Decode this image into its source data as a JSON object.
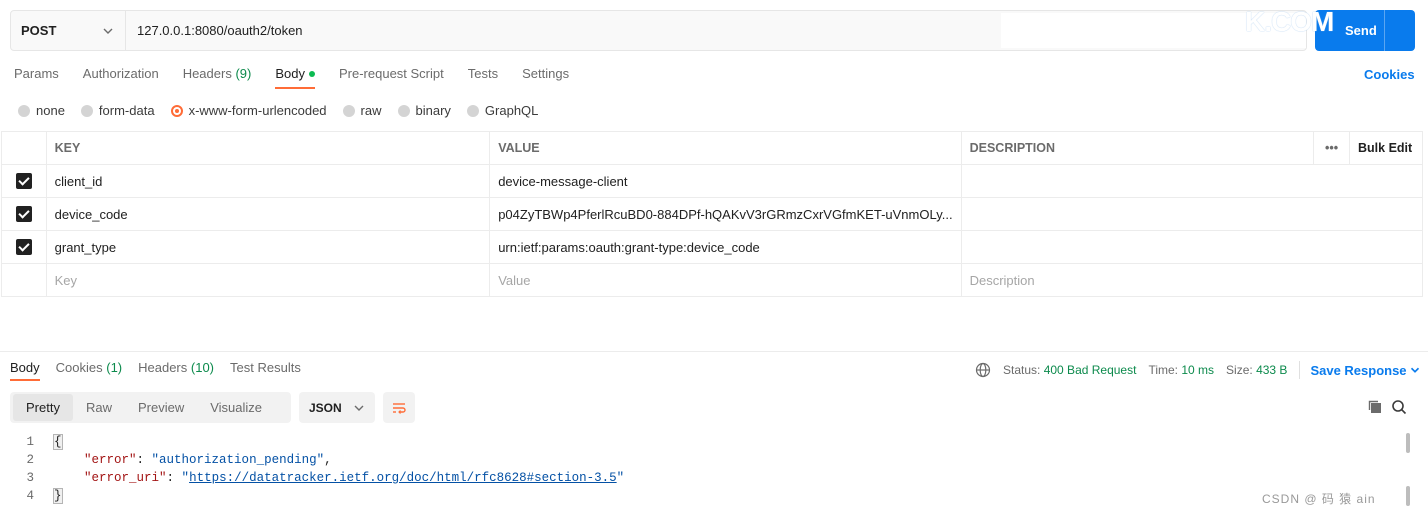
{
  "request": {
    "method": "POST",
    "url": "127.0.0.1:8080/oauth2/token",
    "send_label": "Send",
    "cookies_label": "Cookies"
  },
  "watermark": {
    "top": "K.COM",
    "bottom": "CSDN @ 码 猿 ain"
  },
  "request_tabs": [
    {
      "label": "Params"
    },
    {
      "label": "Authorization"
    },
    {
      "label": "Headers",
      "count": "(9)"
    },
    {
      "label": "Body"
    },
    {
      "label": "Pre-request Script"
    },
    {
      "label": "Tests"
    },
    {
      "label": "Settings"
    }
  ],
  "body_types": [
    {
      "label": "none"
    },
    {
      "label": "form-data"
    },
    {
      "label": "x-www-form-urlencoded",
      "selected": true
    },
    {
      "label": "raw"
    },
    {
      "label": "binary"
    },
    {
      "label": "GraphQL"
    }
  ],
  "params_table": {
    "headers": {
      "key": "KEY",
      "value": "VALUE",
      "description": "DESCRIPTION",
      "more": "•••",
      "bulk_edit": "Bulk Edit"
    },
    "rows": [
      {
        "key": "client_id",
        "value": "device-message-client",
        "description": ""
      },
      {
        "key": "device_code",
        "value": "p04ZyTBWp4PferlRcuBD0-884DPf-hQAKvV3rGRmzCxrVGfmKET-uVnmOLy...",
        "description": ""
      },
      {
        "key": "grant_type",
        "value": "urn:ietf:params:oauth:grant-type:device_code",
        "description": ""
      }
    ],
    "placeholders": {
      "key": "Key",
      "value": "Value",
      "description": "Description"
    }
  },
  "response": {
    "tabs": [
      {
        "label": "Body"
      },
      {
        "label": "Cookies",
        "count": "(1)"
      },
      {
        "label": "Headers",
        "count": "(10)"
      },
      {
        "label": "Test Results"
      }
    ],
    "status_label": "Status:",
    "status_value": "400 Bad Request",
    "time_label": "Time:",
    "time_value": "10 ms",
    "size_label": "Size:",
    "size_value": "433 B",
    "save_label": "Save Response",
    "views": [
      "Pretty",
      "Raw",
      "Preview",
      "Visualize"
    ],
    "format": "JSON",
    "code": {
      "line_numbers": [
        "1",
        "2",
        "3",
        "4"
      ],
      "open_brace": "{",
      "close_brace": "}",
      "error_key": "\"error\"",
      "error_value": "\"authorization_pending\"",
      "error_uri_key": "\"error_uri\"",
      "error_uri_value": "https://datatracker.ietf.org/doc/html/rfc8628#section-3.5"
    }
  },
  "colors": {
    "accent": "#ff6c37",
    "primary": "#097bed",
    "success": "#0c8a4c"
  }
}
